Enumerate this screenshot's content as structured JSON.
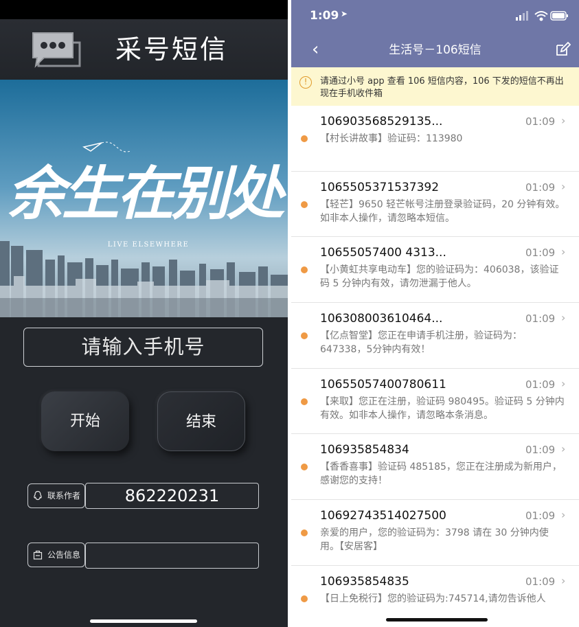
{
  "left_app": {
    "title": "采号短信",
    "app_icon": "chat-bubbles-icon",
    "banner": {
      "headline": "余生在别处",
      "subtitle": "LIVE  ELSEWHERE"
    },
    "phone_input": {
      "placeholder": "请输入手机号"
    },
    "start_button": "开始",
    "stop_button": "结束",
    "contact": {
      "label": "联系作者",
      "icon": "qq-penguin-icon",
      "value": "862220231"
    },
    "notice": {
      "label": "公告信息",
      "icon": "bag-icon",
      "value": ""
    }
  },
  "right_app": {
    "status": {
      "time": "1:09",
      "location_icon": "location-arrow-icon"
    },
    "nav": {
      "back": "‹",
      "title": "生活号－106短信",
      "compose_icon": "compose-icon"
    },
    "notice": "请通过小号 app 查看 106 短信内容，106 下发的短信不再出现在手机收件箱",
    "messages": [
      {
        "number": "106903568529135...",
        "time": "01:09",
        "body": "【村长讲故事】验证码：113980"
      },
      {
        "number": "1065505371537392",
        "time": "01:09",
        "body": "【轻芒】9650 轻芒帐号注册登录验证码，20 分钟有效。如非本人操作，请忽略本短信。"
      },
      {
        "number": "10655057400 4313...",
        "time": "01:09",
        "body": "【小黄虹共享电动车】您的验证码为：406038，该验证码 5 分钟内有效，请勿泄漏于他人。"
      },
      {
        "number": "106308003610464...",
        "time": "01:09",
        "body": "【亿点智堂】您正在申请手机注册，验证码为：647338，5分钟内有效！"
      },
      {
        "number": "10655057400780611",
        "time": "01:09",
        "body": "【来取】您正在注册，验证码 980495。验证码 5 分钟内有效。如非本人操作，请忽略本条消息。"
      },
      {
        "number": "106935854834",
        "time": "01:09",
        "body": "【香香喜事】验证码 485185，您正在注册成为新用户，感谢您的支持！"
      },
      {
        "number": "10692743514027500",
        "time": "01:09",
        "body": "亲爱的用户，您的验证码为：3798 请在 30 分钟内使用。【安居客】"
      },
      {
        "number": "106935854835",
        "time": "01:09",
        "body": "【日上免税行】您的验证码为:745714,请勿告诉他人"
      }
    ]
  }
}
